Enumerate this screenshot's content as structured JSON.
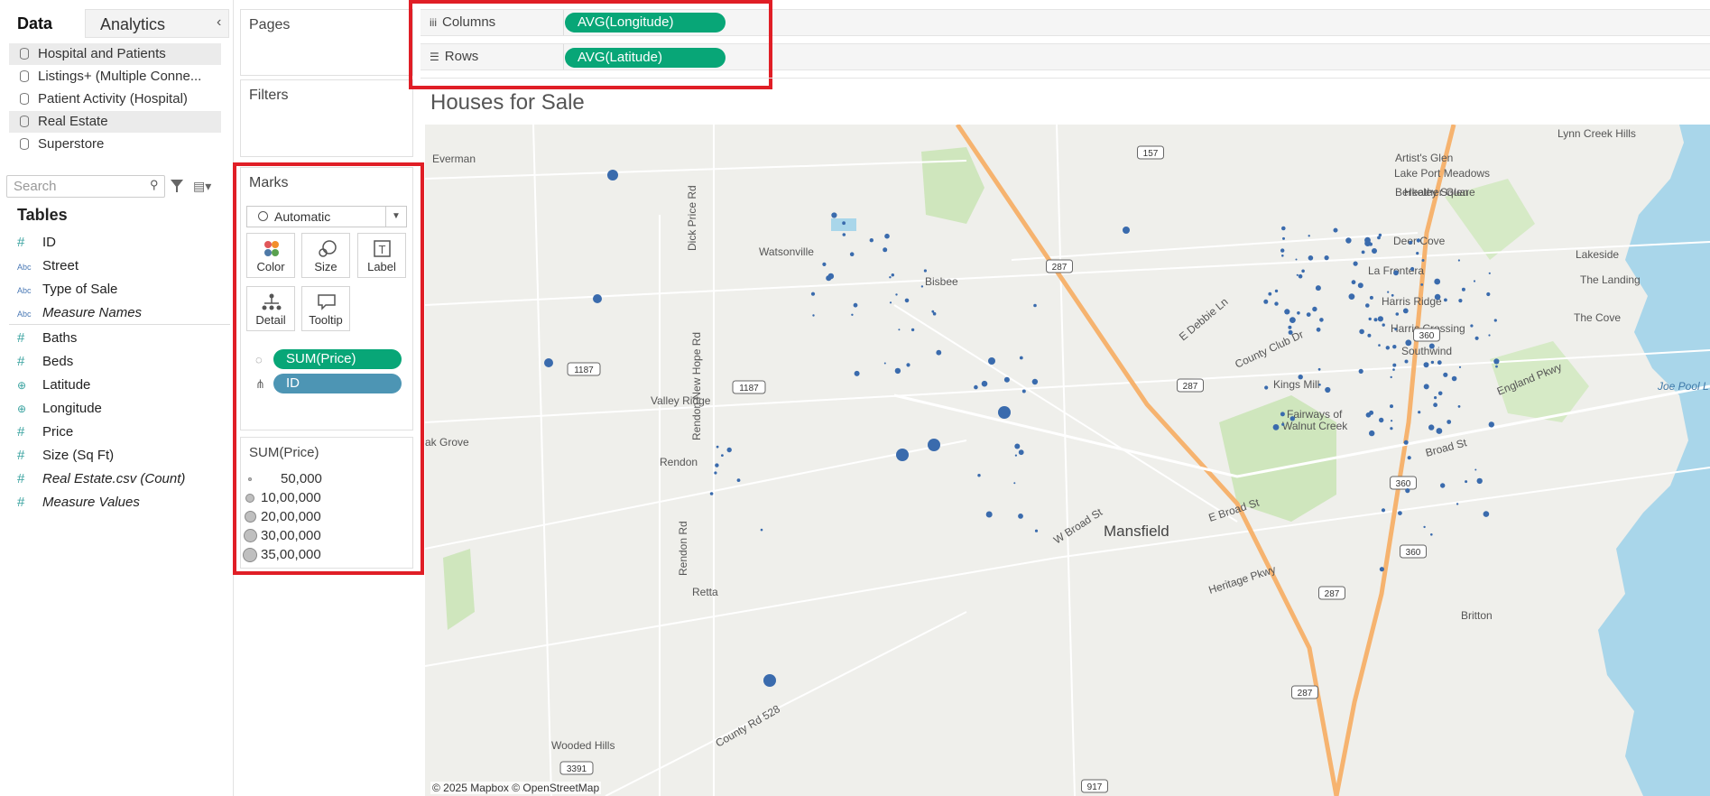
{
  "left_pane": {
    "tab_data": "Data",
    "tab_analytics": "Analytics",
    "collapse_glyph": "‹",
    "datasources": [
      {
        "label": "Hospital and Patients",
        "selected": true
      },
      {
        "label": "Listings+ (Multiple Conne...",
        "selected": false
      },
      {
        "label": "Patient Activity (Hospital)",
        "selected": false
      },
      {
        "label": "Real Estate",
        "selected": true
      },
      {
        "label": "Superstore",
        "selected": false
      }
    ],
    "search_placeholder": "Search",
    "tables_heading": "Tables",
    "fields": [
      {
        "type": "#",
        "kind": "num",
        "label": "ID",
        "italic": false
      },
      {
        "type": "Abc",
        "kind": "abc",
        "label": "Street",
        "italic": false
      },
      {
        "type": "Abc",
        "kind": "abc",
        "label": "Type of Sale",
        "italic": false
      },
      {
        "type": "Abc",
        "kind": "abc",
        "label": "Measure Names",
        "italic": true
      },
      {
        "type": "#",
        "kind": "num",
        "label": "Baths",
        "italic": false
      },
      {
        "type": "#",
        "kind": "num",
        "label": "Beds",
        "italic": false
      },
      {
        "type": "⊕",
        "kind": "geo",
        "label": "Latitude",
        "italic": false
      },
      {
        "type": "⊕",
        "kind": "geo",
        "label": "Longitude",
        "italic": false
      },
      {
        "type": "#",
        "kind": "num",
        "label": "Price",
        "italic": false
      },
      {
        "type": "#",
        "kind": "num",
        "label": "Size (Sq Ft)",
        "italic": false
      },
      {
        "type": "#",
        "kind": "num",
        "label": "Real Estate.csv (Count)",
        "italic": true
      },
      {
        "type": "#",
        "kind": "num",
        "label": "Measure Values",
        "italic": true
      }
    ]
  },
  "shelves": {
    "pages_label": "Pages",
    "filters_label": "Filters",
    "columns_label": "Columns",
    "columns_pill": "AVG(Longitude)",
    "rows_label": "Rows",
    "rows_pill": "AVG(Latitude)"
  },
  "marks": {
    "title": "Marks",
    "mark_type": "Automatic",
    "buttons": [
      "Color",
      "Size",
      "Label",
      "Detail",
      "Tooltip"
    ],
    "pill_size": "SUM(Price)",
    "pill_detail": "ID"
  },
  "legend": {
    "title": "SUM(Price)",
    "items": [
      "50,000",
      "10,00,000",
      "20,00,000",
      "30,00,000",
      "35,00,000"
    ]
  },
  "view": {
    "title": "Houses for Sale",
    "attribution": "© 2025 Mapbox © OpenStreetMap",
    "places": [
      "Everman",
      "Watsonville",
      "Bisbee",
      "Valley Ridge",
      "Rendon",
      "Retta",
      "Mansfield",
      "Britton",
      "Wooded Hills",
      "Artist's Glen",
      "Lake Port Meadows",
      "Berkeley Square",
      "Heather Glen",
      "Deer Cove",
      "La Frontera",
      "Harris Ridge",
      "Harris Crossing",
      "Southwind",
      "Lakeside",
      "The Landing",
      "The Cove",
      "Lynn Creek Hills",
      "Joe Pool L",
      "Fairways of",
      "Walnut Creek",
      "Kings Mill",
      "ak Grove",
      "Dick Price Rd",
      "Rendon New Hope Rd",
      "Rendon Rd",
      "W Broad St",
      "E Broad St",
      "Heritage Pkwy",
      "England Pkwy",
      "County Club Dr",
      "Broad St",
      "County Rd 528",
      "E Debbie Ln"
    ],
    "shields": [
      "157",
      "287",
      "287",
      "287",
      "360",
      "360",
      "360",
      "1187",
      "1187",
      "3391",
      "917",
      "287"
    ],
    "mark_color": "#3a6bad"
  }
}
